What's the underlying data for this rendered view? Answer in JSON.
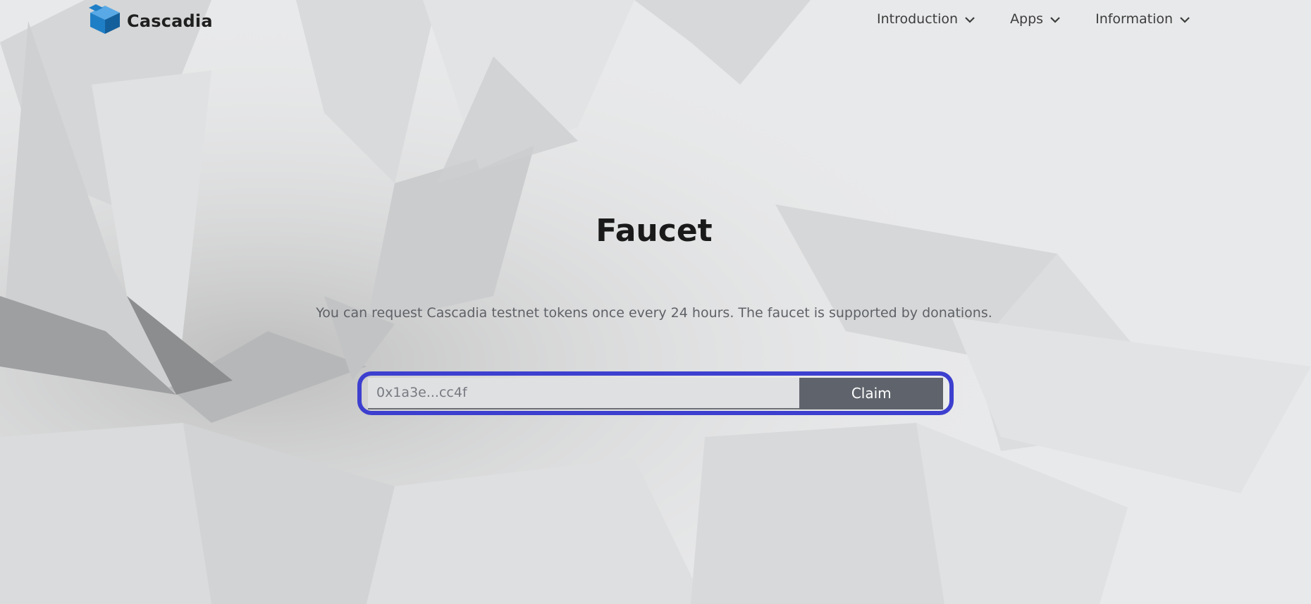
{
  "brand": {
    "name": "Cascadia",
    "logo_icon": "cube-logo-icon",
    "logo_color": "#1f7fc6"
  },
  "nav": {
    "items": [
      {
        "label": "Introduction",
        "icon": "chevron-down-icon"
      },
      {
        "label": "Apps",
        "icon": "chevron-down-icon"
      },
      {
        "label": "Information",
        "icon": "chevron-down-icon"
      }
    ]
  },
  "hero": {
    "title": "Faucet",
    "subtitle": "You can request Cascadia testnet tokens once every 24 hours. The faucet is supported by donations."
  },
  "claim_form": {
    "address_placeholder": "0x1a3e...cc4f",
    "address_value": "",
    "button_label": "Claim",
    "focus_ring_color": "#3d3fcf",
    "button_color": "#5f646c"
  }
}
